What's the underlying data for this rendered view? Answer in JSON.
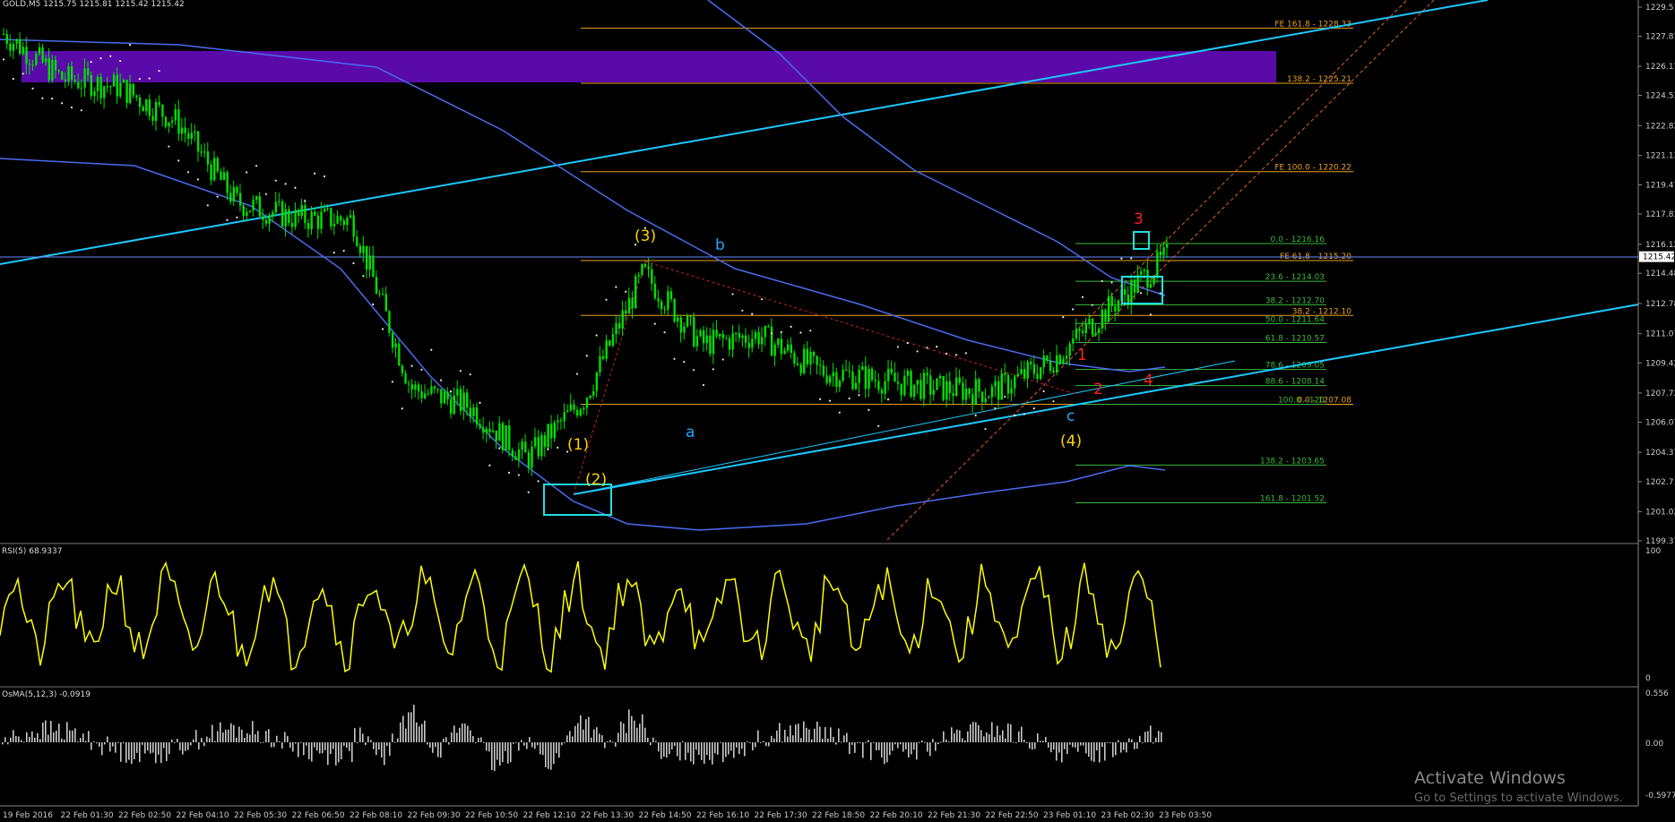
{
  "header": {
    "symbol": "GOLD,M5",
    "ohlc": "1215.75 1215.81 1215.42 1215.42"
  },
  "price_axis": {
    "ticks": [
      "1229.51",
      "1227.87",
      "1226.17",
      "1224.53",
      "1222.82",
      "1221.13",
      "1219.47",
      "1217.83",
      "1216.12",
      "1214.48",
      "1212.78",
      "1211.07",
      "1209.42",
      "1207.72",
      "1206.07",
      "1204.37",
      "1202.71",
      "1201.02",
      "1199.37"
    ],
    "current_price": "1215.42"
  },
  "time_axis": {
    "labels": [
      "19 Feb 2016",
      "22 Feb 01:30",
      "22 Feb 02:50",
      "22 Feb 04:10",
      "22 Feb 05:30",
      "22 Feb 06:50",
      "22 Feb 08:10",
      "22 Feb 09:30",
      "22 Feb 10:50",
      "22 Feb 12:10",
      "22 Feb 13:30",
      "22 Feb 14:50",
      "22 Feb 16:10",
      "22 Feb 17:30",
      "22 Feb 18:50",
      "22 Feb 20:10",
      "22 Feb 21:30",
      "22 Feb 22:50",
      "23 Feb 01:10",
      "23 Feb 02:30",
      "23 Feb 03:50"
    ]
  },
  "fib_levels_orange": [
    {
      "label": "FE 161.8 - 1228.33",
      "price": 1228.33
    },
    {
      "label": "138.2 - 1225.21",
      "price": 1225.21
    },
    {
      "label": "FE 100.0 - 1220.22",
      "price": 1220.22
    },
    {
      "label": "FE 61.8 - 1215.20",
      "price": 1215.2
    },
    {
      "label": "38.2 - 1212.10",
      "price": 1212.1
    },
    {
      "label": "0.0 - 1207.08",
      "price": 1207.08
    }
  ],
  "fib_levels_green": [
    {
      "label": "0.0 - 1216.16",
      "price": 1216.16
    },
    {
      "label": "23.6 - 1214.03",
      "price": 1214.03
    },
    {
      "label": "38.2 - 1212.70",
      "price": 1212.7
    },
    {
      "label": "50.0 - 1211.64",
      "price": 1211.64
    },
    {
      "label": "61.8 - 1210.57",
      "price": 1210.57
    },
    {
      "label": "78.6 - 1209.05",
      "price": 1209.05
    },
    {
      "label": "88.6 - 1208.14",
      "price": 1208.14
    },
    {
      "label": "100.0 - 120",
      "price": 1207.08
    },
    {
      "label": "138.2 - 1203.65",
      "price": 1203.65
    },
    {
      "label": "161.8 - 1201.52",
      "price": 1201.52
    }
  ],
  "wave_labels": [
    {
      "text": "(1)",
      "color": "#ffd400"
    },
    {
      "text": "(2)",
      "color": "#ffd400"
    },
    {
      "text": "(3)",
      "color": "#ffd400"
    },
    {
      "text": "(4)",
      "color": "#ffd400"
    },
    {
      "text": "a",
      "color": "#22a8ff"
    },
    {
      "text": "b",
      "color": "#22a8ff"
    },
    {
      "text": "c",
      "color": "#22a8ff"
    },
    {
      "text": "1",
      "color": "#ff2020"
    },
    {
      "text": "2",
      "color": "#ff2020"
    },
    {
      "text": "3",
      "color": "#ff2020"
    },
    {
      "text": "4",
      "color": "#ff2020"
    }
  ],
  "rsi": {
    "label": "RSI(5) 68.9337",
    "scale": [
      "100",
      "0"
    ]
  },
  "osma": {
    "label": "OsMA(5,12,3) -0.0919",
    "scale": [
      "0.556",
      "0.00",
      "-0.5977"
    ]
  },
  "watermark": {
    "title": "Activate Windows",
    "subtitle": "Go to Settings to activate Windows."
  },
  "colors": {
    "candle_up": "#00e000",
    "candle_down": "#00e000",
    "fib_orange": "#e8a020",
    "fib_green": "#3cb83c",
    "trend_line": "#1ec8ff",
    "ma_line": "#4a6cf0",
    "zone": "#5a0aa8",
    "rsi_line": "#ffff00",
    "osma_bar": "#c8c8c8"
  },
  "chart_data": {
    "type": "candlestick",
    "title": "GOLD,M5",
    "ylim": [
      1199.37,
      1229.51
    ],
    "close_path": [
      {
        "t": "19 Feb 2016",
        "v": 1228.0
      },
      {
        "t": "22 Feb 01:30",
        "v": 1225.5
      },
      {
        "t": "22 Feb 02:50",
        "v": 1225.0
      },
      {
        "t": "22 Feb 04:10",
        "v": 1223.0
      },
      {
        "t": "22 Feb 05:30",
        "v": 1218.5
      },
      {
        "t": "22 Feb 06:50",
        "v": 1217.6
      },
      {
        "t": "22 Feb 08:10",
        "v": 1217.5
      },
      {
        "t": "22 Feb 09:30",
        "v": 1208.0
      },
      {
        "t": "22 Feb 10:50",
        "v": 1207.0
      },
      {
        "t": "22 Feb 12:10",
        "v": 1204.0
      },
      {
        "t": "22 Feb 13:30",
        "v": 1207.5
      },
      {
        "t": "22 Feb 14:50",
        "v": 1214.5
      },
      {
        "t": "22 Feb 16:10",
        "v": 1210.5
      },
      {
        "t": "22 Feb 17:30",
        "v": 1211.0
      },
      {
        "t": "22 Feb 18:50",
        "v": 1209.0
      },
      {
        "t": "22 Feb 20:10",
        "v": 1208.5
      },
      {
        "t": "22 Feb 21:30",
        "v": 1208.0
      },
      {
        "t": "22 Feb 22:50",
        "v": 1207.8
      },
      {
        "t": "23 Feb 01:10",
        "v": 1209.5
      },
      {
        "t": "23 Feb 02:30",
        "v": 1212.5
      },
      {
        "t": "23 Feb 03:50",
        "v": 1215.42
      }
    ]
  }
}
